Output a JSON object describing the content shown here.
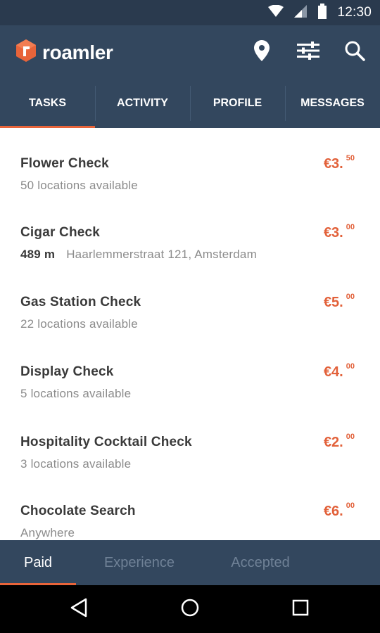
{
  "status_bar": {
    "time": "12:30",
    "icons": [
      "wifi-icon",
      "cell-signal-icon",
      "battery-icon"
    ]
  },
  "app": {
    "name": "roamler",
    "brand_color": "#e8643a",
    "header_color": "#33475e"
  },
  "header_actions": [
    "location-pin-icon",
    "filter-sliders-icon",
    "search-icon"
  ],
  "tabs": [
    {
      "label": "TASKS",
      "active": true
    },
    {
      "label": "ACTIVITY",
      "active": false
    },
    {
      "label": "PROFILE",
      "active": false
    },
    {
      "label": "MESSAGES",
      "active": false
    }
  ],
  "tasks": [
    {
      "title": "Flower Check",
      "subtitle": "50 locations available",
      "price_main": "€3.",
      "price_cents": "50"
    },
    {
      "title": "Cigar Check",
      "distance": "489 m",
      "subtitle": "Haarlemmerstraat 121, Amsterdam",
      "price_main": "€3.",
      "price_cents": "00"
    },
    {
      "title": "Gas Station Check",
      "subtitle": "22 locations available",
      "price_main": "€5.",
      "price_cents": "00"
    },
    {
      "title": "Display Check",
      "subtitle": "5 locations available",
      "price_main": "€4.",
      "price_cents": "00"
    },
    {
      "title": "Hospitality Cocktail Check",
      "subtitle": "3 locations available",
      "price_main": "€2.",
      "price_cents": "00"
    },
    {
      "title": "Chocolate Search",
      "subtitle": "Anywhere",
      "price_main": "€6.",
      "price_cents": "00"
    }
  ],
  "filter_tabs": [
    {
      "label": "Paid",
      "active": true
    },
    {
      "label": "Experience",
      "active": false
    },
    {
      "label": "Accepted",
      "active": false
    }
  ],
  "nav_bar": [
    "back-icon",
    "home-icon",
    "recents-icon"
  ]
}
